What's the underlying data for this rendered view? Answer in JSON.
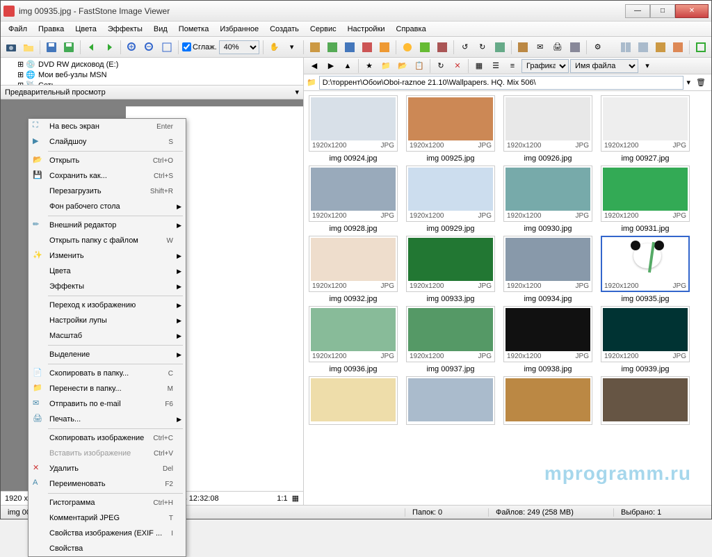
{
  "title": "img 00935.jpg  -  FastStone Image Viewer",
  "menu": [
    "Файл",
    "Правка",
    "Цвета",
    "Эффекты",
    "Вид",
    "Пометка",
    "Избранное",
    "Создать",
    "Сервис",
    "Настройки",
    "Справка"
  ],
  "toolbar": {
    "smooth_label": "Сглаж.",
    "zoom_value": "40%"
  },
  "tree": {
    "items": [
      {
        "label": "DVD RW дисковод (E:)"
      },
      {
        "label": "Мои веб-узлы MSN"
      },
      {
        "label": "Сеть"
      }
    ]
  },
  "preview_header": "Предварительный просмотр",
  "preview_status": {
    "left": "1920 x 1200 (2.30 MP)  24bit  JPG  190 KB  2013-10-28 12:32:08",
    "right": "1:1"
  },
  "right_toolbar": {
    "group_label": "Графика",
    "sort_label": "Имя файла"
  },
  "path": "D:\\торрент\\Обои\\Oboi-raznoe 21.10\\Wallpapers. HQ. Mix 506\\",
  "thumbs": [
    {
      "name": "img 00924.jpg",
      "dim": "1920x1200",
      "fmt": "JPG",
      "bg": "#d8e0e8"
    },
    {
      "name": "img 00925.jpg",
      "dim": "1920x1200",
      "fmt": "JPG",
      "bg": "#c85"
    },
    {
      "name": "img 00926.jpg",
      "dim": "1920x1200",
      "fmt": "JPG",
      "bg": "#e8e8e8"
    },
    {
      "name": "img 00927.jpg",
      "dim": "1920x1200",
      "fmt": "JPG",
      "bg": "#eee"
    },
    {
      "name": "img 00928.jpg",
      "dim": "1920x1200",
      "fmt": "JPG",
      "bg": "#9ab"
    },
    {
      "name": "img 00929.jpg",
      "dim": "1920x1200",
      "fmt": "JPG",
      "bg": "#cde"
    },
    {
      "name": "img 00930.jpg",
      "dim": "1920x1200",
      "fmt": "JPG",
      "bg": "#7aa"
    },
    {
      "name": "img 00931.jpg",
      "dim": "1920x1200",
      "fmt": "JPG",
      "bg": "#3a5"
    },
    {
      "name": "img 00932.jpg",
      "dim": "1920x1200",
      "fmt": "JPG",
      "bg": "#edc"
    },
    {
      "name": "img 00933.jpg",
      "dim": "1920x1200",
      "fmt": "JPG",
      "bg": "#273"
    },
    {
      "name": "img 00934.jpg",
      "dim": "1920x1200",
      "fmt": "JPG",
      "bg": "#89a"
    },
    {
      "name": "img 00935.jpg",
      "dim": "1920x1200",
      "fmt": "JPG",
      "bg": "#fff",
      "selected": true
    },
    {
      "name": "img 00936.jpg",
      "dim": "1920x1200",
      "fmt": "JPG",
      "bg": "#8b9"
    },
    {
      "name": "img 00937.jpg",
      "dim": "1920x1200",
      "fmt": "JPG",
      "bg": "#596"
    },
    {
      "name": "img 00938.jpg",
      "dim": "1920x1200",
      "fmt": "JPG",
      "bg": "#111"
    },
    {
      "name": "img 00939.jpg",
      "dim": "1920x1200",
      "fmt": "JPG",
      "bg": "#033"
    },
    {
      "name": "",
      "dim": "",
      "fmt": "",
      "bg": "#eda"
    },
    {
      "name": "",
      "dim": "",
      "fmt": "",
      "bg": "#abc"
    },
    {
      "name": "",
      "dim": "",
      "fmt": "",
      "bg": "#b84"
    },
    {
      "name": "",
      "dim": "",
      "fmt": "",
      "bg": "#654"
    }
  ],
  "status": {
    "file": "img 00935.jpg  [ 168 / 249 ]",
    "folders": "Папок: 0",
    "files": "Файлов: 249 (258 MB)",
    "selected": "Выбрано: 1"
  },
  "context": [
    {
      "icon": "fullscreen",
      "label": "На весь экран",
      "shortcut": "Enter"
    },
    {
      "icon": "slideshow",
      "label": "Слайдшоу",
      "shortcut": "S"
    },
    {
      "sep": true
    },
    {
      "icon": "open",
      "label": "Открыть",
      "shortcut": "Ctrl+O"
    },
    {
      "icon": "save",
      "label": "Сохранить как...",
      "shortcut": "Ctrl+S"
    },
    {
      "icon": "",
      "label": "Перезагрузить",
      "shortcut": "Shift+R"
    },
    {
      "icon": "",
      "label": "Фон рабочего стола",
      "arrow": true
    },
    {
      "sep": true
    },
    {
      "icon": "ext-edit",
      "label": "Внешний редактор",
      "arrow": true
    },
    {
      "icon": "",
      "label": "Открыть папку с файлом",
      "shortcut": "W"
    },
    {
      "icon": "wand",
      "label": "Изменить",
      "arrow": true
    },
    {
      "icon": "",
      "label": "Цвета",
      "arrow": true
    },
    {
      "icon": "",
      "label": "Эффекты",
      "arrow": true
    },
    {
      "sep": true
    },
    {
      "icon": "",
      "label": "Переход к изображению",
      "arrow": true
    },
    {
      "icon": "",
      "label": "Настройки лупы",
      "arrow": true
    },
    {
      "icon": "",
      "label": "Масштаб",
      "arrow": true
    },
    {
      "sep": true
    },
    {
      "icon": "",
      "label": "Выделение",
      "arrow": true
    },
    {
      "sep": true
    },
    {
      "icon": "copy-to",
      "label": "Скопировать в папку...",
      "shortcut": "C"
    },
    {
      "icon": "move-to",
      "label": "Перенести в папку...",
      "shortcut": "M"
    },
    {
      "icon": "mail",
      "label": "Отправить по e-mail",
      "shortcut": "F6"
    },
    {
      "icon": "print",
      "label": "Печать...",
      "arrow": true
    },
    {
      "sep": true
    },
    {
      "icon": "",
      "label": "Скопировать изображение",
      "shortcut": "Ctrl+C"
    },
    {
      "icon": "",
      "label": "Вставить изображение",
      "shortcut": "Ctrl+V",
      "disabled": true
    },
    {
      "icon": "delete",
      "label": "Удалить",
      "shortcut": "Del"
    },
    {
      "icon": "rename",
      "label": "Переименовать",
      "shortcut": "F2"
    },
    {
      "sep": true
    },
    {
      "icon": "",
      "label": "Гистограмма",
      "shortcut": "Ctrl+H"
    },
    {
      "icon": "",
      "label": "Комментарий JPEG",
      "shortcut": "T"
    },
    {
      "icon": "",
      "label": "Свойства изображения (EXIF ...",
      "shortcut": "I"
    },
    {
      "icon": "",
      "label": "Свойства"
    }
  ],
  "watermark": "mprogramm.ru"
}
